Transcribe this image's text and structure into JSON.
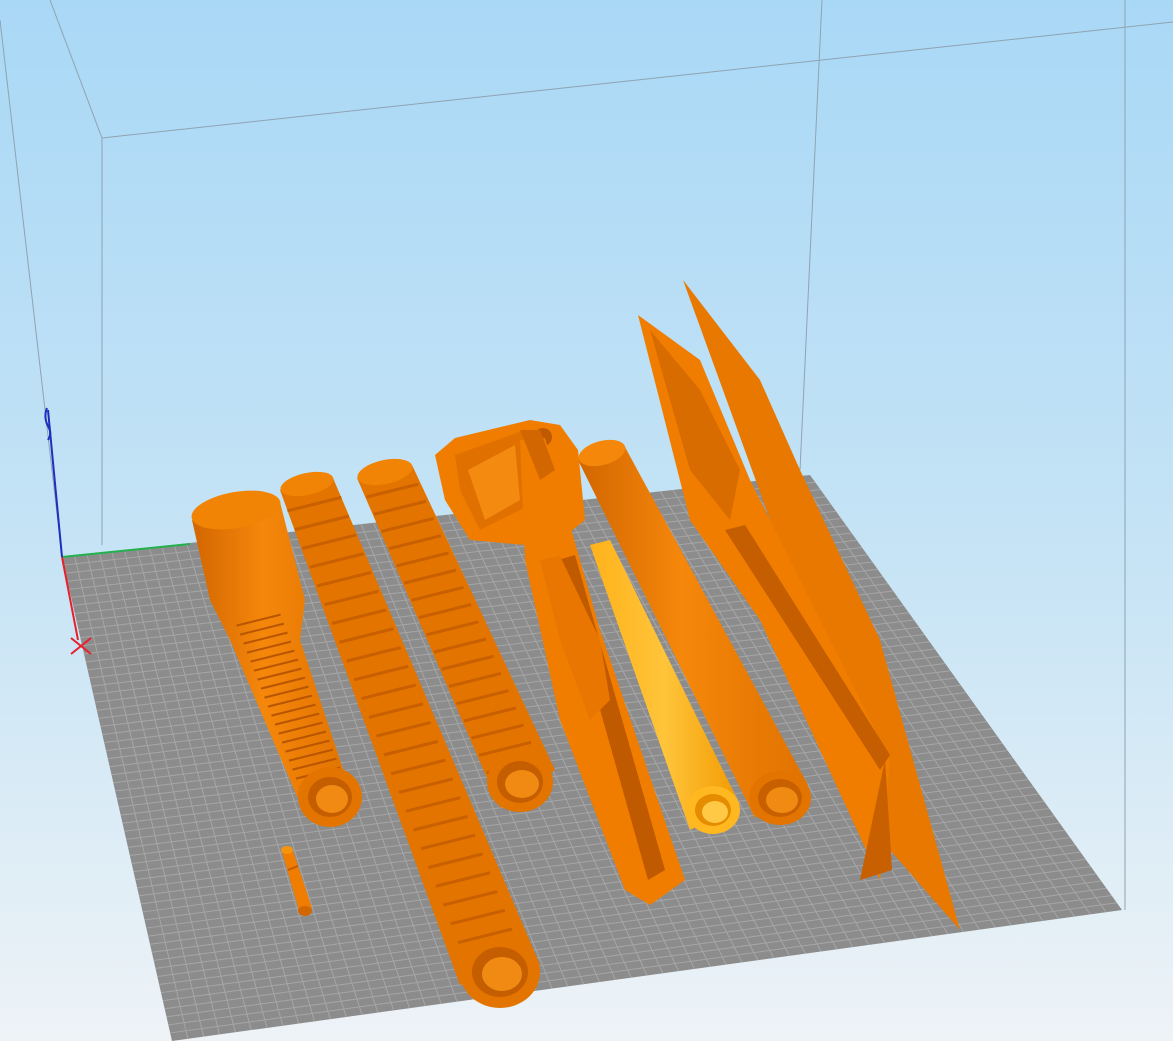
{
  "viewport": {
    "app_type": "3d-slicer-build-plate-view",
    "background_top": "#a9d8f6",
    "background_bottom": "#eef3f7"
  },
  "build_volume": {
    "frame_color": "#8fa3b2",
    "plate_color": "#8c8c8c",
    "grid_color": "#a6a6a6"
  },
  "axes": {
    "x_color": "#e8202a",
    "y_color": "#22b14c",
    "z_color": "#1d2fbf",
    "origin_marker_icon": "origin-cross-icon"
  },
  "models": {
    "color_main": "#f07d00",
    "color_shadow": "#cf6500",
    "color_highlight": "#ff9a1f",
    "color_selected": "#ffae00",
    "parts": [
      {
        "name": "nozzle-tube",
        "selected": false
      },
      {
        "name": "small-pin",
        "selected": false
      },
      {
        "name": "long-ribbed-tube",
        "selected": false
      },
      {
        "name": "middle-ribbed-tube",
        "selected": false
      },
      {
        "name": "handle-body",
        "selected": false
      },
      {
        "name": "yellow-cone",
        "selected": true
      },
      {
        "name": "plain-tube",
        "selected": false
      },
      {
        "name": "blade-panel",
        "selected": false
      }
    ]
  }
}
